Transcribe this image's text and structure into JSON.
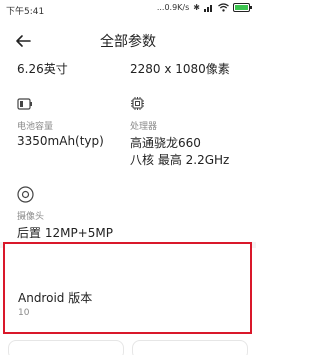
{
  "status": {
    "time": "下午5:41",
    "speed": "...0.9K/s"
  },
  "header": {
    "title": "全部参数"
  },
  "screen": {
    "size": "6.26英寸",
    "resolution": "2280 x 1080像素"
  },
  "battery_spec": {
    "label": "电池容量",
    "value": "3350mAh(typ)"
  },
  "processor": {
    "label": "处理器",
    "line1": "高通骁龙660",
    "line2": "八核 最高 2.2GHz"
  },
  "camera": {
    "label": "摄像头",
    "value": "后置 12MP+5MP"
  },
  "android": {
    "title": "Android 版本",
    "version": "10"
  },
  "colors": {
    "highlight": "#d9182a",
    "battery_fill": "#3cc34f"
  },
  "icons": [
    "back-arrow-icon",
    "battery-icon",
    "chip-icon",
    "camera-icon",
    "bluetooth-icon",
    "wifi-icon"
  ]
}
